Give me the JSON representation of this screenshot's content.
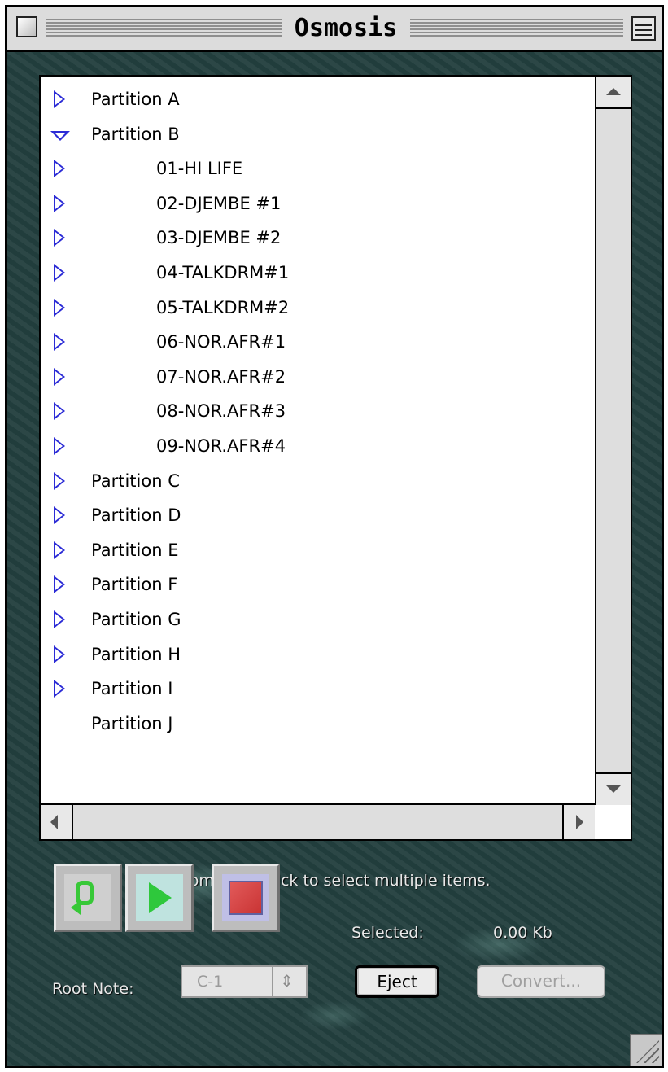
{
  "window": {
    "title": "Osmosis"
  },
  "tree": [
    {
      "label": "Partition A",
      "indent": 0,
      "state": "collapsed"
    },
    {
      "label": "Partition B",
      "indent": 0,
      "state": "expanded"
    },
    {
      "label": "01-HI LIFE",
      "indent": 1,
      "state": "collapsed"
    },
    {
      "label": "02-DJEMBE #1",
      "indent": 1,
      "state": "collapsed"
    },
    {
      "label": "03-DJEMBE #2",
      "indent": 1,
      "state": "collapsed"
    },
    {
      "label": "04-TALKDRM#1",
      "indent": 1,
      "state": "collapsed"
    },
    {
      "label": "05-TALKDRM#2",
      "indent": 1,
      "state": "collapsed"
    },
    {
      "label": "06-NOR.AFR#1",
      "indent": 1,
      "state": "collapsed"
    },
    {
      "label": "07-NOR.AFR#2",
      "indent": 1,
      "state": "collapsed"
    },
    {
      "label": "08-NOR.AFR#3",
      "indent": 1,
      "state": "collapsed"
    },
    {
      "label": "09-NOR.AFR#4",
      "indent": 1,
      "state": "collapsed"
    },
    {
      "label": "Partition C",
      "indent": 0,
      "state": "collapsed"
    },
    {
      "label": "Partition D",
      "indent": 0,
      "state": "collapsed"
    },
    {
      "label": "Partition E",
      "indent": 0,
      "state": "collapsed"
    },
    {
      "label": "Partition F",
      "indent": 0,
      "state": "collapsed"
    },
    {
      "label": "Partition G",
      "indent": 0,
      "state": "collapsed"
    },
    {
      "label": "Partition H",
      "indent": 0,
      "state": "collapsed"
    },
    {
      "label": "Partition I",
      "indent": 0,
      "state": "collapsed"
    },
    {
      "label": "Partition J",
      "indent": 0,
      "state": "none"
    }
  ],
  "hint": "Command-click to select multiple items.",
  "controls": {
    "loop_icon": "loop-arrow-icon",
    "play_icon": "play-icon",
    "stop_icon": "stop-icon"
  },
  "status": {
    "selected_label": "Selected:",
    "selected_value": "0.00 Kb"
  },
  "root_note": {
    "label": "Root Note:",
    "value": "C-1"
  },
  "buttons": {
    "eject": "Eject",
    "convert": "Convert..."
  },
  "colors": {
    "disclosure": "#2b2bd6",
    "background": "#23403f"
  }
}
